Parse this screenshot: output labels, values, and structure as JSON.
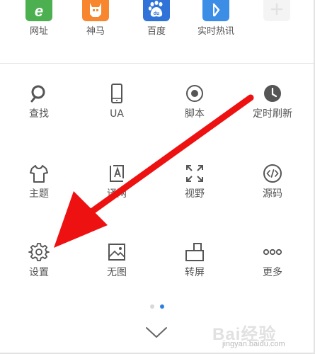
{
  "apps": [
    {
      "label": "网址",
      "icon": "web-icon",
      "color": "#4CAF50"
    },
    {
      "label": "神马",
      "icon": "shenma-icon",
      "color": "#F7862F"
    },
    {
      "label": "百度",
      "icon": "baidu-icon",
      "color": "#2F73D9"
    },
    {
      "label": "实时热讯",
      "icon": "hotnews-icon",
      "color": "#3B8DE6"
    },
    {
      "label": "",
      "icon": "add-icon",
      "color": "#F2F2F2"
    }
  ],
  "tools": [
    {
      "label": "查找",
      "icon": "search-icon"
    },
    {
      "label": "UA",
      "icon": "phone-icon"
    },
    {
      "label": "脚本",
      "icon": "script-icon"
    },
    {
      "label": "定时刷新",
      "icon": "clock-icon"
    },
    {
      "label": "主题",
      "icon": "shirt-icon"
    },
    {
      "label": "译网",
      "icon": "translate-icon"
    },
    {
      "label": "视野",
      "icon": "expand-icon"
    },
    {
      "label": "源码",
      "icon": "source-code-icon"
    },
    {
      "label": "设置",
      "icon": "gear-icon"
    },
    {
      "label": "无图",
      "icon": "no-image-icon"
    },
    {
      "label": "转屏",
      "icon": "rotate-screen-icon"
    },
    {
      "label": "更多",
      "icon": "more-icon"
    }
  ],
  "pager": {
    "active_index": 1,
    "count": 2,
    "active_color": "#2F7FE0",
    "inactive_color": "#D8D8D8"
  },
  "annotation": {
    "color": "#EE1111",
    "points_to": "设置"
  },
  "watermark": {
    "text": "Bai经验",
    "url": "jingyan.baidu.com"
  }
}
